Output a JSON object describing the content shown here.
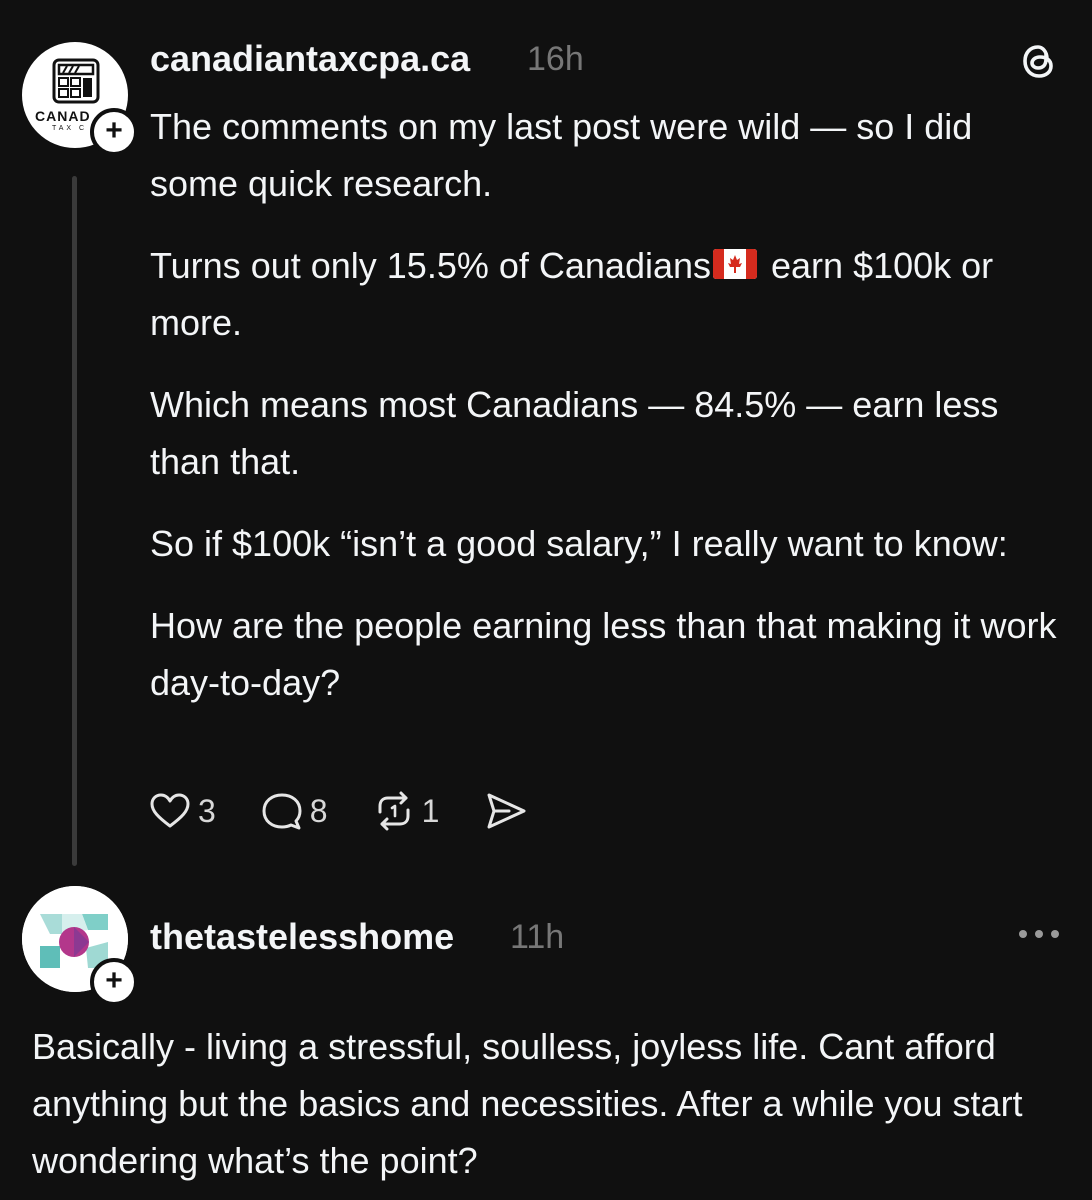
{
  "post": {
    "username": "canadiantaxcpa.ca",
    "time": "16h",
    "avatar_text_top": "CANAD",
    "avatar_text_bottom": "TAX C",
    "p1": "The comments on my last post were wild — so I did some quick research.",
    "p2_before_flag": "Turns out only 15.5% of Canadians",
    "p2_after_flag": "earn $100k or more.",
    "p3": "Which means most Canadians — 84.5% — earn less than that.",
    "p4": "So if $100k “isn’t a good salary,” I really want to know:",
    "p5": "How are the people earning less than that making it work day-to-day?",
    "likes": "3",
    "comments": "8",
    "reposts": "1"
  },
  "reply": {
    "username": "thetastelesshome",
    "time": "11h",
    "text": "Basically - living a stressful, soulless, joyless life. Cant afford anything but the basics and necessities. After a while you start wondering what’s the point?"
  },
  "icons": {
    "threads": "threads-logo-icon",
    "like": "heart-icon",
    "comment": "comment-bubble-icon",
    "repost": "repost-icon",
    "share": "send-icon",
    "more": "more-dots-icon",
    "follow": "plus-icon"
  },
  "colors": {
    "background": "#101010",
    "text": "#f3f5f7",
    "muted": "#777777"
  }
}
